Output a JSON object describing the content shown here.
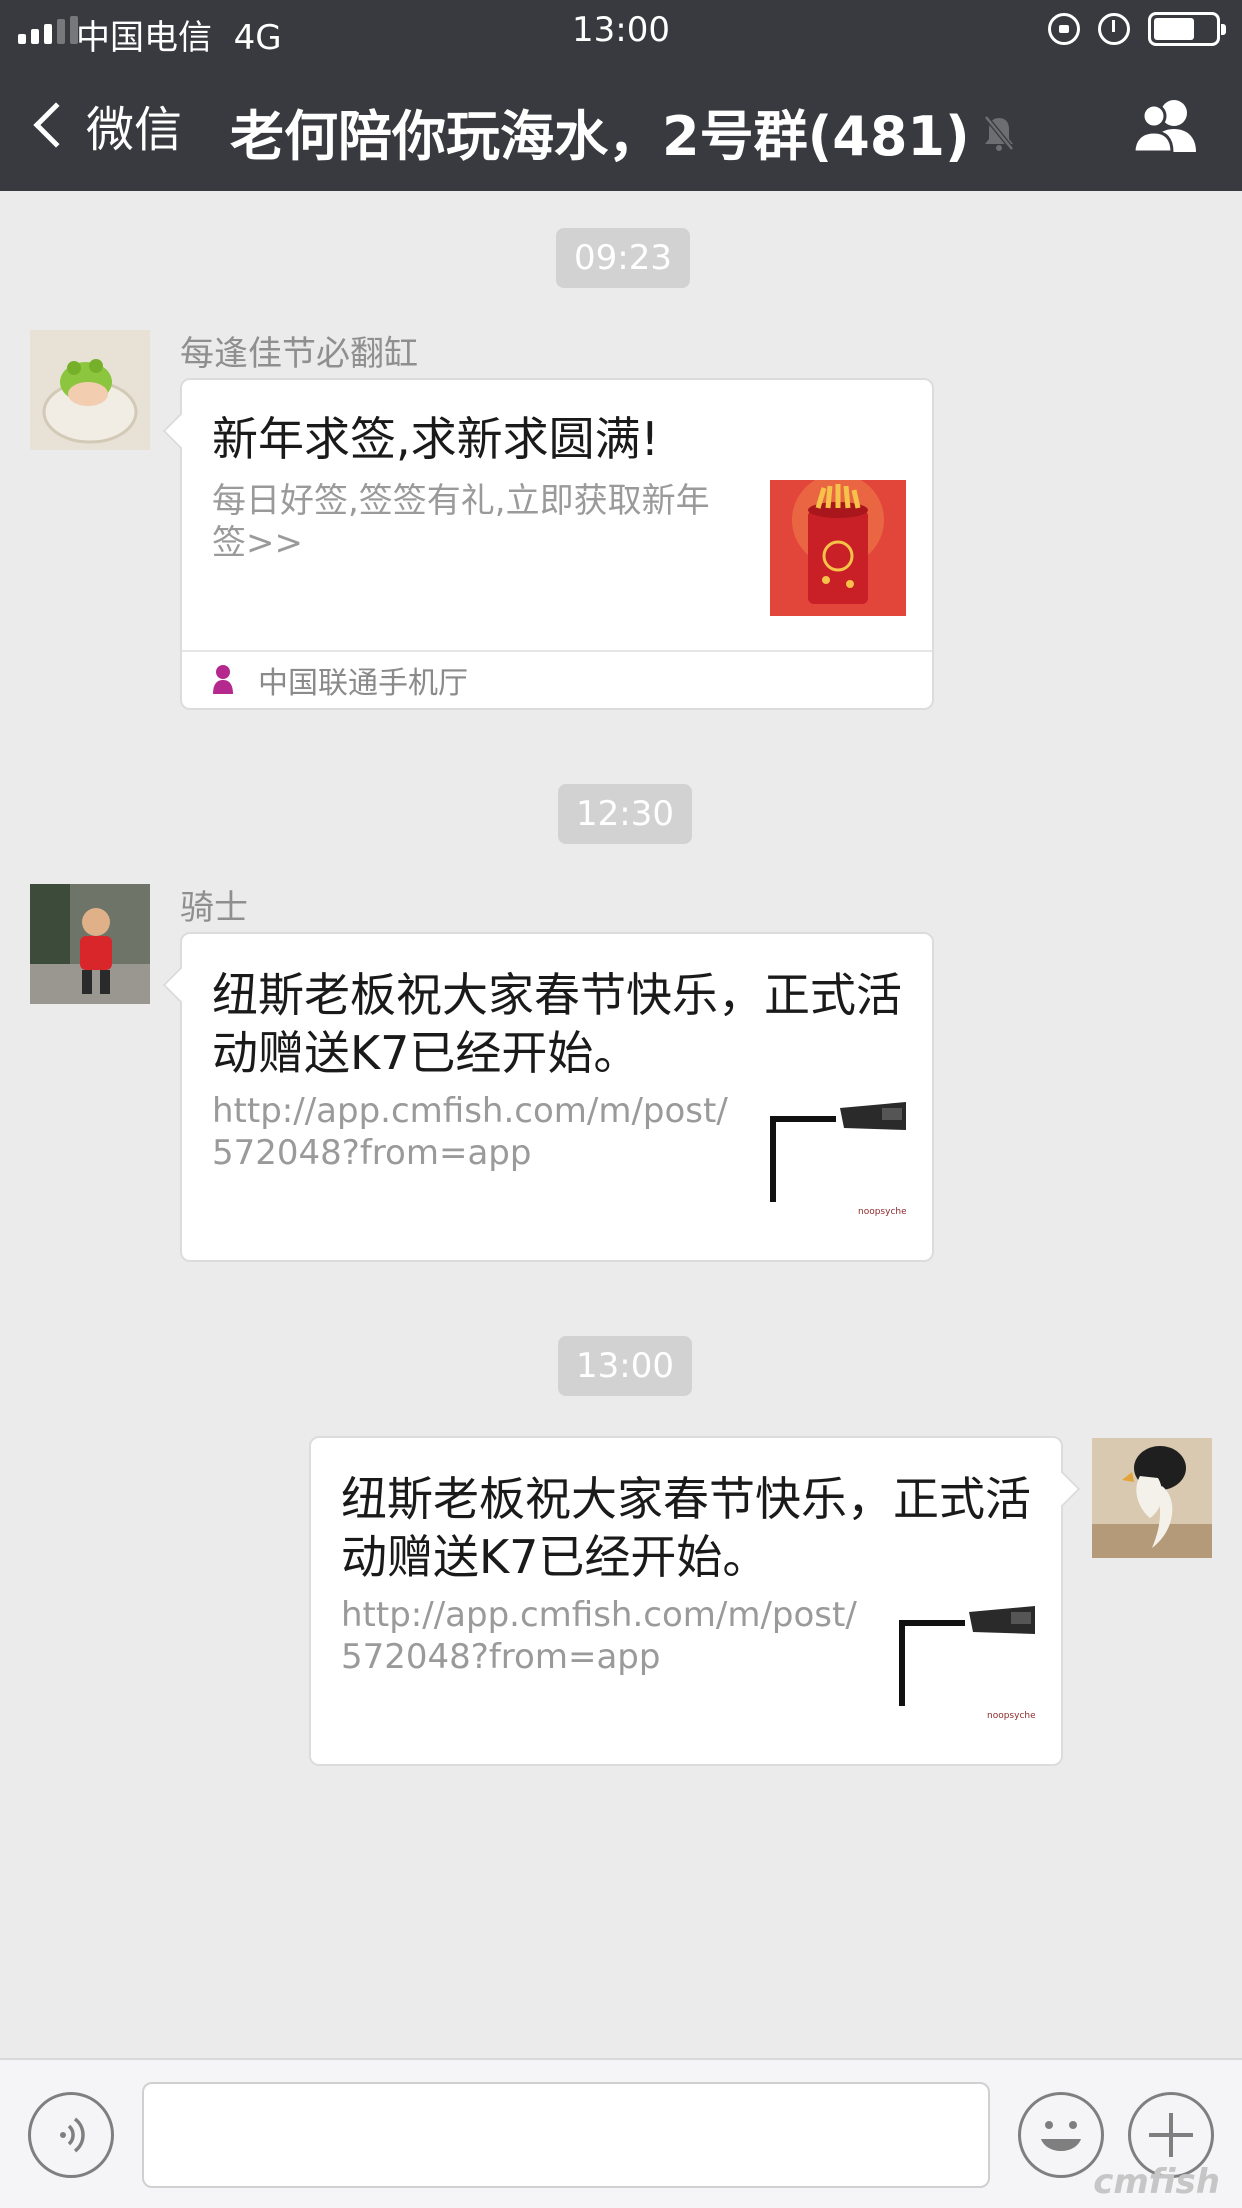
{
  "status_bar": {
    "carrier": "中国电信",
    "network": "4G",
    "time": "13:00"
  },
  "nav": {
    "back_label": "微信",
    "title": "老何陪你玩海水，2号群(481)",
    "icons": {
      "back": "chevron-left-icon",
      "mute": "bell-off-icon",
      "members": "group-icon"
    }
  },
  "messages": [
    {
      "time": "09:23",
      "sender": "每逢佳节必翻缸",
      "title": "新年求签,求新求圆满!",
      "description": "每日好签,签签有礼,立即获取新年签>>",
      "source": "中国联通手机厅"
    },
    {
      "time": "12:30",
      "sender": "骑士",
      "title": "纽斯老板祝大家春节快乐，正式活动赠送K7已经开始。",
      "description": "http://app.cmfish.com/m/post/572048?from=app"
    },
    {
      "time": "13:00",
      "title": "纽斯老板祝大家春节快乐，正式活动赠送K7已经开始。",
      "description": "http://app.cmfish.com/m/post/572048?from=app"
    }
  ],
  "input_bar": {
    "icons": {
      "voice": "voice-icon",
      "emoji": "emoji-icon",
      "more": "plus-icon"
    }
  },
  "watermark": "cmfish",
  "colors": {
    "nav_background": "#393a3f",
    "chat_background": "#ebebeb",
    "time_pill": "#d2d2d2",
    "bubble": "#ffffff"
  }
}
